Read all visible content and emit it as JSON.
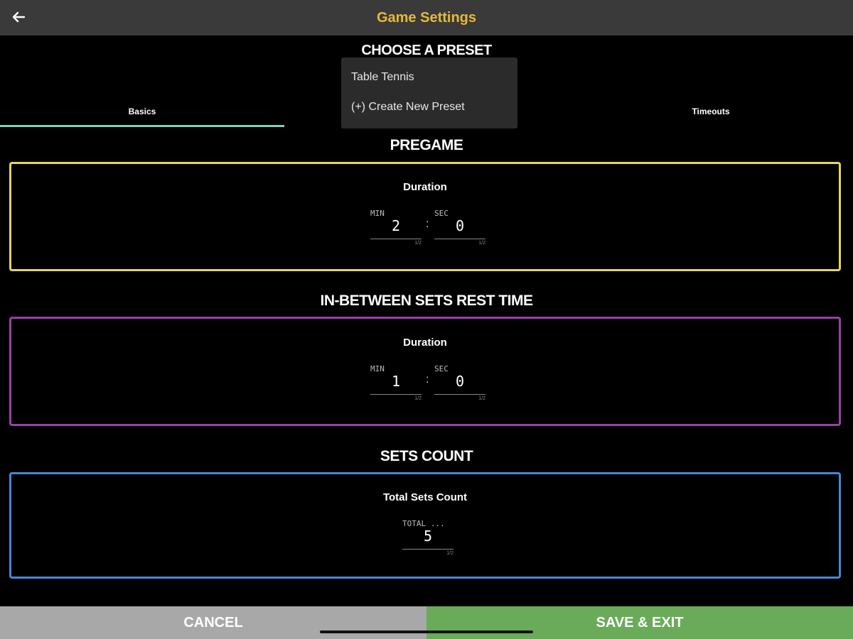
{
  "header": {
    "title": "Game Settings",
    "back_icon": "arrow-left-icon"
  },
  "preset": {
    "heading": "CHOOSE A PRESET",
    "options": [
      "Table Tennis",
      "(+) Create New Preset"
    ]
  },
  "tabs": [
    {
      "label": "Basics",
      "active": true
    },
    {
      "label": "",
      "active": false
    },
    {
      "label": "Timeouts",
      "active": false
    }
  ],
  "sections": {
    "pregame": {
      "title": "PREGAME",
      "label": "Duration",
      "min_caption": "MIN",
      "min_value": "2",
      "min_counter": "1/2",
      "sec_caption": "SEC",
      "sec_value": "0",
      "sec_counter": "1/2",
      "border_color": "#e6d463"
    },
    "rest": {
      "title": "IN-BETWEEN SETS REST TIME",
      "label": "Duration",
      "min_caption": "MIN",
      "min_value": "1",
      "min_counter": "1/2",
      "sec_caption": "SEC",
      "sec_value": "0",
      "sec_counter": "1/2",
      "border_color": "#9b3fa8"
    },
    "sets": {
      "title": "SETS COUNT",
      "label": "Total Sets Count",
      "total_caption": "TOTAL ...",
      "total_value": "5",
      "total_counter": "1/2",
      "border_color": "#4a86d4"
    }
  },
  "footer": {
    "cancel_label": "CANCEL",
    "save_label": "SAVE & EXIT"
  }
}
